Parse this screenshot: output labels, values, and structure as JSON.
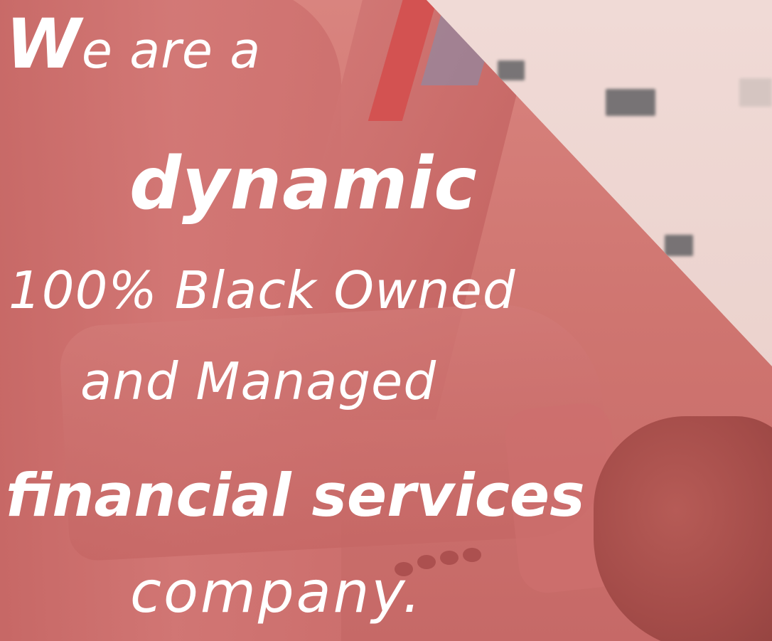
{
  "colors": {
    "overlay_red": "#c96e6c",
    "building": "#ebd2cd",
    "text": "#ffffff"
  },
  "headline": {
    "line1_initial": "W",
    "line1_rest": "e are a",
    "line2": "dynamic",
    "line3": "100% Black Owned",
    "line4": "and Managed",
    "line5": "financial services",
    "line6": "company."
  }
}
